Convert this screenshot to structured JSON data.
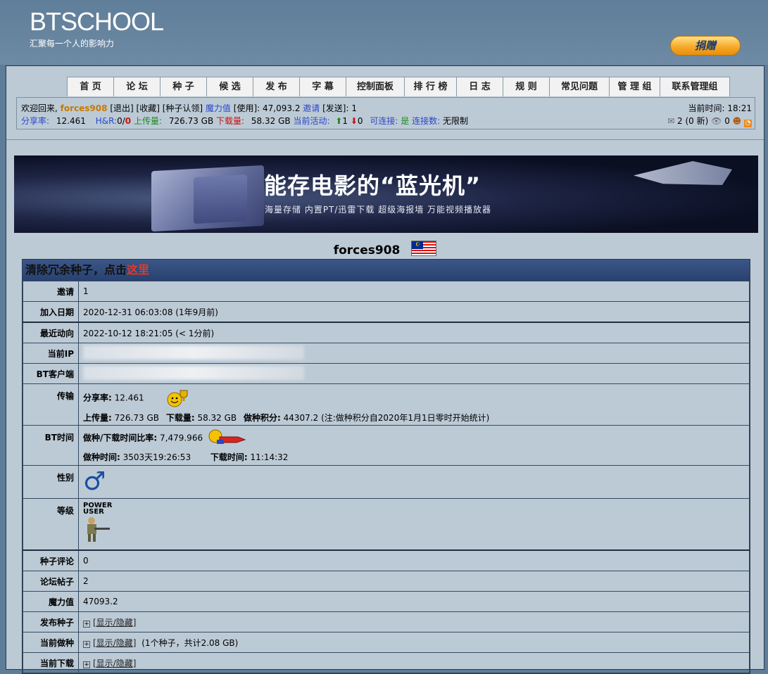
{
  "header": {
    "site_title": "BTSCHOOL",
    "slogan": "汇聚每一个人的影响力",
    "donate": "捐赠"
  },
  "nav": [
    "首 页",
    "论 坛",
    "种 子",
    "候 选",
    "发 布",
    "字 幕",
    "控制面板",
    "排 行 榜",
    "日 志",
    "规 则",
    "常见问题",
    "管 理 组",
    "联系管理组"
  ],
  "infobar": {
    "welcome": "欢迎回来,",
    "username": "forces908",
    "logout": "[退出]",
    "favorites": "[收藏]",
    "claim": "[种子认领]",
    "bonus_label": "魔力值",
    "bonus_use": "[使用]:",
    "bonus_value": "47,093.2",
    "invite_label": "邀请",
    "invite_send": "[发送]:",
    "invite_value": "1",
    "time_label": "当前时间:",
    "time_value": "18:21",
    "ratio_label": "分享率:",
    "ratio_value": "12.461",
    "hr_label": "H&R:",
    "hr_value_a": "0/",
    "hr_value_b": "0",
    "upload_label": "上传量:",
    "upload_value": "726.73 GB",
    "download_label": "下载量:",
    "download_value": "58.32 GB",
    "active_label": "当前活动:",
    "active_seed": "1",
    "active_leech": "0",
    "connectable_label": "可连接:",
    "connectable_value": "是",
    "conn_count_label": "连接数:",
    "conn_count_value": "无限制",
    "messages": "2 (0 新)",
    "bookmarks": "0"
  },
  "banner": {
    "title": "能存电影的“蓝光机”",
    "subtitle": "海量存储   内置PT/迅雷下载   超级海报墙   万能视频播放器"
  },
  "profile": {
    "username": "forces908",
    "notice_prefix": "清除冗余种子，点击",
    "notice_link": "这里",
    "rows": {
      "invite_label": "邀请",
      "invite_value": "1",
      "joined_label": "加入日期",
      "joined_value": "2020-12-31 06:03:08 (1年9月前)",
      "last_label": "最近动向",
      "last_value": "2022-10-12 18:21:05 (< 1分前)",
      "ip_label": "当前IP",
      "client_label": "BT客户端",
      "transfer_label": "传输",
      "ratio_label": "分享率:",
      "ratio_value": "12.461",
      "upload_label": "上传量:",
      "upload_value": "726.73 GB",
      "download_label": "下载量:",
      "download_value": "58.32 GB",
      "seedpoints_label": "做种积分:",
      "seedpoints_value": "44307.2 (注:做种积分自2020年1月1日零时开始统计)",
      "bttime_label": "BT时间",
      "seed_ratio_label": "做种/下载时间比率:",
      "seed_ratio_value": "7,479.966",
      "seed_time_label": "做种时间:",
      "seed_time_value": "3503天19:26:53",
      "dl_time_label": "下载时间:",
      "dl_time_value": "11:14:32",
      "gender_label": "性别",
      "class_label": "等级",
      "class_value_1": "POWER",
      "class_value_2": "USER",
      "comments_label": "种子评论",
      "comments_value": "0",
      "posts_label": "论坛帖子",
      "posts_value": "2",
      "bonus_label": "魔力值",
      "bonus_value": "47093.2",
      "uploaded_label": "发布种子",
      "toggle_text": "[显示/隐藏]",
      "seeding_label": "当前做种",
      "seeding_extra": "(1个种子，共计2.08 GB)",
      "leeching_label": "当前下载"
    }
  }
}
